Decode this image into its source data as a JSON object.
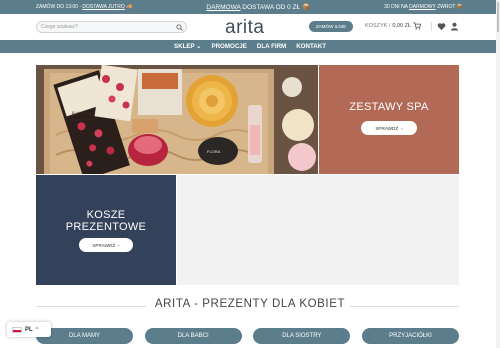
{
  "topbar": {
    "left_prefix": "ZAMÓW DO 13:00 - ",
    "left_link": "DOSTAWA JUTRO",
    "center_link": "DARMOWA",
    "center_rest": " DOSTAWA OD 0 ZŁ",
    "right_prefix": "30 DNI NA ",
    "right_link": "DARMOWY",
    "right_rest": " ZWROT"
  },
  "header": {
    "search_placeholder": "Czego szukasz?",
    "logo": "arita",
    "order_label": "ZAMÓW ILNIE",
    "cart_label": "KOSZYK /",
    "cart_total": "0,00 ZŁ"
  },
  "nav": {
    "items": [
      "SKLEP",
      "PROMOCJE",
      "DLA FIRM",
      "KONTAKT"
    ],
    "sklep_caret": "⌄"
  },
  "tiles": {
    "spa_title": "ZESTAWY SPA",
    "spa_button": "SPRAWDŹ",
    "kosze_title_1": "KOSZE",
    "kosze_title_2": "PREZENTOWE",
    "kosze_button": "SPRAWDŹ",
    "arrow": "›"
  },
  "section": {
    "title": "ARITA - PREZENTY DLA KOBIET"
  },
  "categories": [
    "DLA MAMY",
    "DLA BABCI",
    "DLA SIOSTRY",
    "PRZYJACIÓŁKI"
  ],
  "language": {
    "code": "PL",
    "caret": "^"
  },
  "colors": {
    "brand": "#5c7e8c",
    "spa_tile": "#b26a57",
    "kosze_tile": "#33415a",
    "blank_tile": "#f2f2f2"
  },
  "product_image": {
    "chocolate_label_1": "Kalorenati",
    "chocolate_label_2": "Rose Chocolate",
    "jar_label": "FLORA"
  }
}
